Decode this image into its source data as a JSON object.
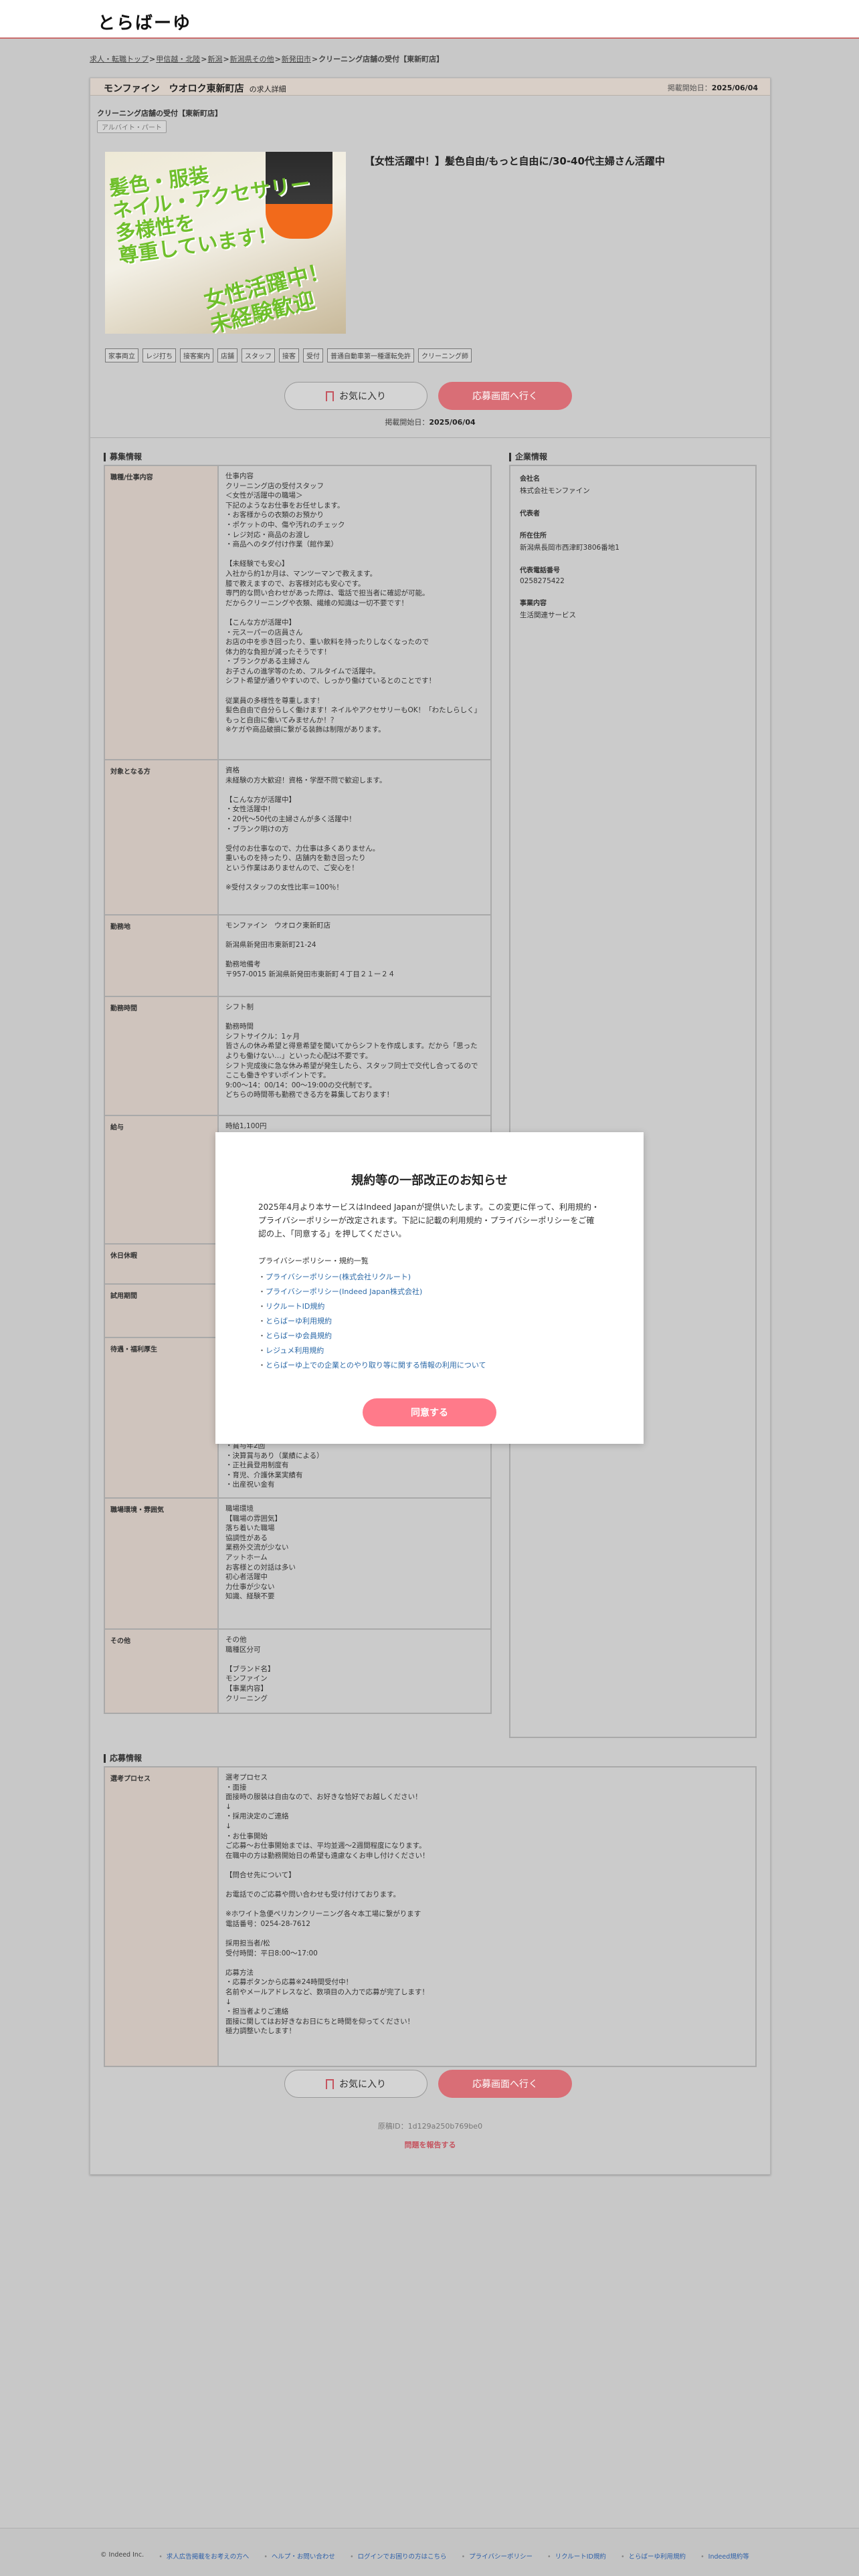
{
  "header": {
    "logo": "とらばーゆ"
  },
  "breadcrumb": {
    "items": [
      "求人・転職トップ",
      "甲信越・北陸",
      "新潟",
      "新潟県その他",
      "新発田市"
    ],
    "current": "クリーニング店舗の受付【東新町店】",
    "separator": ">"
  },
  "job": {
    "company_name": "モンファイン　ウオロク東新町店",
    "company_suffix": "の求人詳細",
    "post_date_label": "掲載開始日：",
    "post_date": "2025/06/04",
    "subtitle": "クリーニング店舗の受付【東新町店】",
    "employment_type": "アルバイト・パート",
    "catchphrase": "【女性活躍中！】髪色自由/もっと自由に/30-40代主婦さん活躍中",
    "hero_text_lines": [
      "髪色・服装",
      "ネイル・アクセサリー",
      "多様性を",
      "尊重しています！"
    ],
    "hero_text_lines2": [
      "女性活躍中！",
      "未経験歓迎"
    ],
    "tags": [
      "家事両立",
      "レジ打ち",
      "接客案内",
      "店舗",
      "スタッフ",
      "接客",
      "受付",
      "普通自動車第一種運転免許",
      "クリーニング師"
    ],
    "fav_label": "お気に入り",
    "apply_label": "応募画面へ行く"
  },
  "sections": {
    "recruit_title": "募集情報",
    "company_title": "企業情報",
    "apply_title": "応募情報"
  },
  "recruit": [
    {
      "label": "職種/仕事内容",
      "text": "仕事内容\nクリーニング店の受付スタッフ\n＜女性が活躍中の職場＞\n下記のようなお仕事をお任せします。\n・お客様からの衣類のお預かり\n・ポケットの中、傷や汚れのチェック\n・レジ対応・商品のお渡し\n・商品へのタグ付け作業（館作業）\n\n【未経験でも安心】\n入社から約1か月は、マンツーマンで教えます。\n膝で教えますので、お客様対応も安心です。\n専門的な問い合わせがあった際は、電話で担当者に確認が可能。\nだからクリーニングや衣類、繊維の知識は一切不要です！\n\n【こんな方が活躍中】\n・元スーパーの店員さん\nお店の中を歩き回ったり、重い飲料を持ったりしなくなったので\n体力的な負担が減ったそうです！\n・ブランクがある主婦さん\nお子さんの進学等のため、フルタイムで活躍中。\nシフト希望が通りやすいので、しっかり働けているとのことです！\n\n従業員の多様性を尊重します！\n髪色自由で自分らしく働けます！ネイルやアクセサリーもOK！「わたしらしく」もっと自由に働いてみませんか！？\n※ケガや商品破損に繋がる装飾は制限があります。"
    },
    {
      "label": "対象となる方",
      "text": "資格\n未経験の方大歓迎！資格・学歴不問で歓迎します。\n\n【こんな方が活躍中】\n・女性活躍中！\n・20代〜50代の主婦さんが多く活躍中！\n・ブランク明けの方\n\n受付のお仕事なので、力仕事は多くありません。\n重いものを持ったり、店舗内を動き回ったり\nという作業はありませんので、ご安心を！\n\n※受付スタッフの女性比率＝100％！"
    },
    {
      "label": "勤務地",
      "text": "モンファイン　ウオロク東新町店\n\n新潟県新発田市東新町21-24\n\n勤務地備考\n〒957-0015 新潟県新発田市東新町４丁目２１ー２４"
    },
    {
      "label": "勤務時間",
      "text": "シフト制\n\n勤務時間\nシフトサイクル：1ヶ月\n皆さんの休み希望と得意希望を聞いてからシフトを作成します。だから「思ったよりも働けない…」といった心配は不要です。\nシフト完成後に急な休み希望が発生したら、スタッフ同士で交代し合ってるのでここも働きやすいポイントです。\n9:00〜14：00/14：00〜19:00の交代制です。\nどちらの時間帯も勤務できる方を募集しております！"
    },
    {
      "label": "給与",
      "text": "時給1,100円"
    },
    {
      "label": "休日休暇",
      "text": ""
    },
    {
      "label": "試用期間",
      "text": ""
    },
    {
      "label": "待遇・福利厚生",
      "text": "\n\n\n\n\n\n\n\n・交通費規定支給\n・車通勤可\n・賞与年2回\n・決算賞与あり（業績による）\n・正社員登用制度有\n・育児、介護休業実績有\n・出産祝い金有"
    },
    {
      "label": "職場環境・雰囲気",
      "text": "職場環境\n【職場の雰囲気】\n落ち着いた職場\n協調性がある\n業務外交流が少ない\nアットホーム\nお客様との対話は多い\n初心者活躍中\n力仕事が少ない\n知識、経験不要"
    },
    {
      "label": "その他",
      "text": "その他\n職種区分可\n\n【ブランド名】\nモンファイン\n【事業内容】\nクリーニング"
    }
  ],
  "company": [
    {
      "label": "会社名",
      "value": "株式会社モンファイン"
    },
    {
      "label": "代表者",
      "value": ""
    },
    {
      "label": "所在住所",
      "value": "新潟県長岡市西津町3806番地1"
    },
    {
      "label": "代表電話番号",
      "value": "0258275422"
    },
    {
      "label": "事業内容",
      "value": "生活関連サービス"
    }
  ],
  "apply": [
    {
      "label": "選考プロセス",
      "text": "選考プロセス\n・面接\n面接時の服装は自由なので、お好きな恰好でお越しください！\n↓\n・採用決定のご連絡\n↓\n・お仕事開始\nご応募〜お仕事開始までは、平均並週〜2週間程度になります。\n在職中の方は勤務開始日の希望も遠慮なくお申し付けください！\n\n【問合せ先について】\n\nお電話でのご応募や問い合わせも受け付けております。\n\n※ホワイト急便ペリカンクリーニング各々本工場に繋がります\n電話番号：0254-28-7612\n\n採用担当者/松\n受付時間：平日8:00〜17:00\n\n応募方法\n・応募ボタンから応募※24時間受付中！\n名前やメールアドレスなど、数項目の入力で応募が完了します！\n↓\n・担当者よりご連絡\n面接に関してはお好きなお日にちと時間を仰ってください！\n極力調整いたします！"
    }
  ],
  "footer": {
    "copyright": "© Indeed Inc.",
    "links": [
      "求人広告掲載をお考えの方へ",
      "ヘルプ・お問い合わせ",
      "ログインでお困りの方はこちら",
      "プライバシーポリシー",
      "リクルートID規約",
      "とらばーゆ利用規約",
      "Indeed規約等"
    ]
  },
  "bottom": {
    "short_id": "原稿ID：1d129a250b769be0",
    "report": "問題を報告する"
  },
  "modal": {
    "title": "規約等の一部改正のお知らせ",
    "body": "2025年4月より本サービスはIndeed Japanが提供いたします。この変更に伴って、利用規約・プライバシーポリシーが改定されます。下記に記載の利用規約・プライバシーポリシーをご確認の上、「同意する」を押してください。",
    "list_title": "プライバシーポリシー・規約一覧",
    "links": [
      "プライバシーポリシー(株式会社リクルート)",
      "プライバシーポリシー(Indeed Japan株式会社)",
      "リクルートID規約",
      "とらばーゆ利用規約",
      "とらばーゆ会員規約",
      "レジュメ利用規約",
      "とらばーゆ上での企業とのやり取り等に関する情報の利用について"
    ],
    "agree_label": "同意する"
  },
  "colors": {
    "accent": "#d96e76",
    "header_line": "#c96d6d",
    "link": "#2d6aa8",
    "agree": "#ff7a8a"
  }
}
